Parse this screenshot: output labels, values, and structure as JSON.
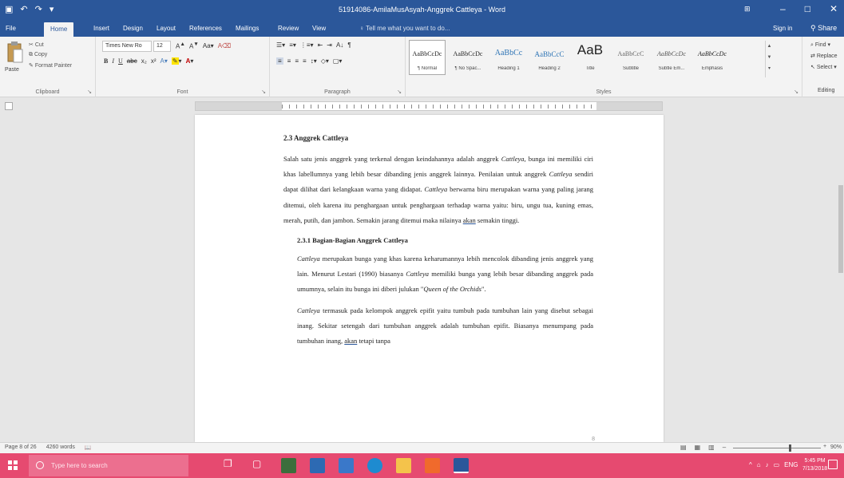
{
  "window": {
    "title": "51914086-AmilaMusAsyah-Anggrek Cattleya - Word",
    "controls": {
      "minimize": "–",
      "maximize": "□",
      "close": "✕"
    },
    "ribbon_display_options": "⊞"
  },
  "quick_access": {
    "save_icon": "save-icon",
    "undo_icon": "undo-icon",
    "redo_icon": "redo-icon",
    "customize": "▾"
  },
  "tabs": [
    {
      "label": "File"
    },
    {
      "label": "Home"
    },
    {
      "label": "Insert"
    },
    {
      "label": "Design"
    },
    {
      "label": "Layout"
    },
    {
      "label": "References"
    },
    {
      "label": "Mailings"
    },
    {
      "label": "Review"
    },
    {
      "label": "View"
    }
  ],
  "tell_me": "Tell me what you want to do...",
  "signin": "Sign in",
  "share": "Share",
  "ribbon": {
    "clipboard": {
      "paste": "Paste",
      "cut": "Cut",
      "copy": "Copy",
      "format_painter": "Format Painter",
      "label": "Clipboard"
    },
    "font": {
      "name": "Times New Ro",
      "size": "12",
      "label": "Font"
    },
    "paragraph": {
      "label": "Paragraph"
    },
    "styles": {
      "label": "Styles",
      "items": [
        {
          "preview": "AaBbCcDc",
          "name": "¶ Normal"
        },
        {
          "preview": "AaBbCcDc",
          "name": "¶ No Spac..."
        },
        {
          "preview": "AaBbCc",
          "name": "Heading 1"
        },
        {
          "preview": "AaBbCcC",
          "name": "Heading 2"
        },
        {
          "preview": "AaB",
          "name": "Title"
        },
        {
          "preview": "AaBbCcC",
          "name": "Subtitle"
        },
        {
          "preview": "AaBbCcDc",
          "name": "Subtle Em..."
        },
        {
          "preview": "AaBbCcDc",
          "name": "Emphasis"
        }
      ]
    },
    "editing": {
      "find": "Find",
      "replace": "Replace",
      "select": "Select",
      "label": "Editing"
    }
  },
  "document": {
    "heading": "2.3 Anggrek Cattleya",
    "p1": [
      "Salah satu jenis anggrek yang terkenal dengan keindahannya adalah anggrek ",
      "Cattleya",
      ", bunga ini memiliki ciri khas labellumnya yang lebih besar dibanding jenis anggrek lainnya. Penilaian untuk anggrek ",
      "Cattleya",
      " sendiri dapat dilihat dari kelangkaan warna yang didapat. ",
      "Cattleya",
      " berwarna biru merupakan warna yang paling jarang ditemui, oleh karena itu penghargaan untuk penghargaan terhadap warna yaitu: biru, ungu tua, kuning emas, merah, putih, dan jambon. Semakin jarang ditemui maka nilainya ",
      "akan",
      " semakin tinggi."
    ],
    "subheading": "2.3.1 Bagian-Bagian Anggrek Cattleya",
    "p2": [
      "Cattleya",
      " merupakan bunga yang khas karena keharumannya lebih mencolok dibanding jenis anggrek yang lain. Menurut Lestari (1990) biasanya ",
      "Cattleya",
      " memiliki bunga yang lebih besar dibanding anggrek pada umumnya, selain itu bunga ini diberi julukan \"",
      "Queen of the Orchids",
      "\"."
    ],
    "p3": [
      "Cattleya",
      " termasuk pada kelompok anggrek epifit yaitu tumbuh pada tumbuhan lain yang disebut sebagai inang. Sekitar setengah dari tumbuhan anggrek adalah tumbuhan epifit. Biasanya menumpang pada tumbuhan inang, ",
      "akan",
      " tetapi tanpa"
    ],
    "page_number": "8"
  },
  "status": {
    "page": "Page 8 of 26",
    "words": "4260 words",
    "zoom": "90%"
  },
  "taskbar": {
    "search_placeholder": "Type here to search",
    "time": "5:45 PM",
    "date": "7/13/2018"
  }
}
